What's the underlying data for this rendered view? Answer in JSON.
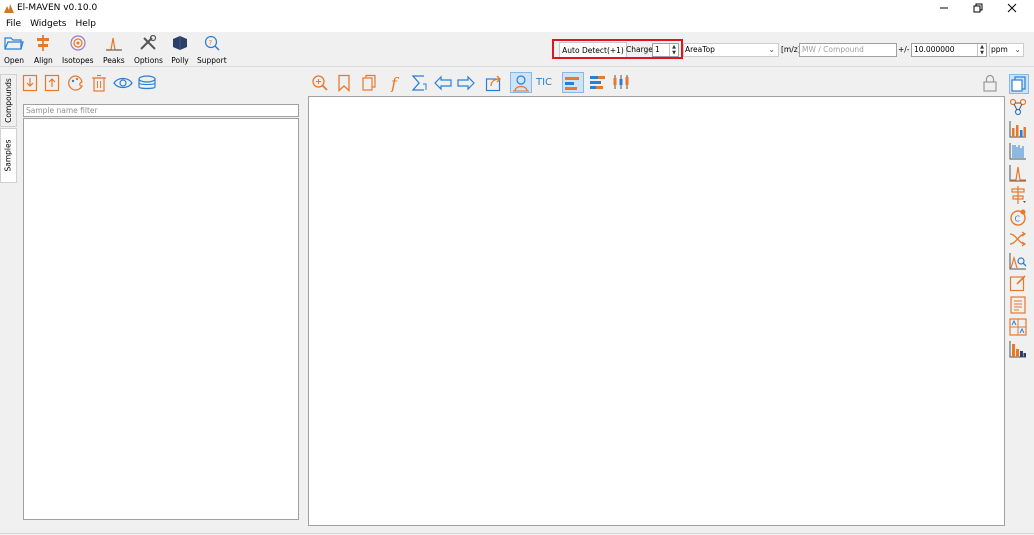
{
  "window": {
    "title": "El-MAVEN v0.10.0"
  },
  "menubar": {
    "items": [
      "File",
      "Widgets",
      "Help"
    ]
  },
  "main_toolbar": {
    "buttons": [
      {
        "label": "Open",
        "icon": "folder-open-icon"
      },
      {
        "label": "Align",
        "icon": "align-icon"
      },
      {
        "label": "Isotopes",
        "icon": "isotopes-icon"
      },
      {
        "label": "Peaks",
        "icon": "peaks-icon"
      },
      {
        "label": "Options",
        "icon": "options-icon"
      },
      {
        "label": "Polly",
        "icon": "polly-icon"
      },
      {
        "label": "Support",
        "icon": "support-icon"
      }
    ],
    "auto_detect_label": "Auto Detect(+1)",
    "charge_label": "Charge",
    "charge_value": "1",
    "quant_type": "AreaTop",
    "mz_label": "[m/z]",
    "mz_placeholder": "MW / Compound",
    "tolerance_label": "+/-",
    "tolerance_value": "10.000000",
    "tolerance_unit": "ppm"
  },
  "side_tabs": [
    "Compounds",
    "Samples"
  ],
  "samples_panel": {
    "filter_placeholder": "Sample name filter"
  },
  "center_toolbar": {
    "tic_label": "TIC"
  },
  "colors": {
    "highlight_red": "#e0141c",
    "icon_orange": "#e8792b",
    "icon_blue": "#2a7fd4"
  }
}
